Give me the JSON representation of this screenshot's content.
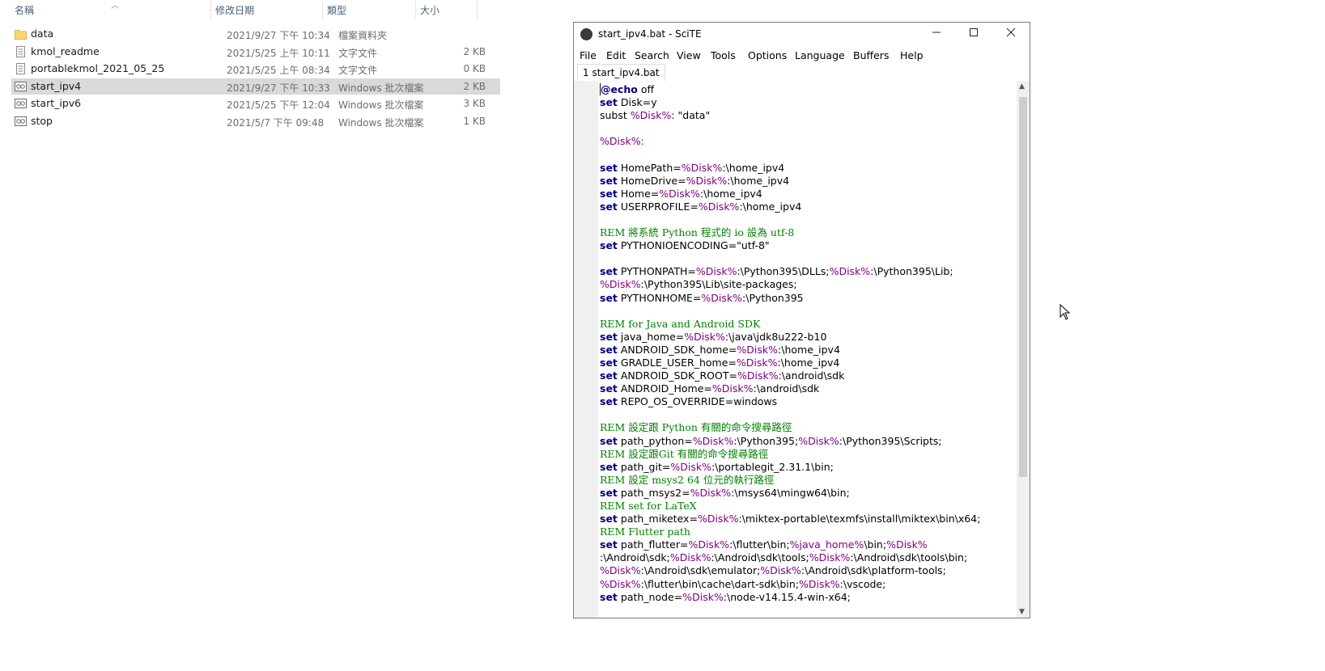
{
  "explorer": {
    "columns": {
      "name": "名稱",
      "date": "修改日期",
      "type": "類型",
      "size": "大小"
    },
    "files": [
      {
        "name": "data",
        "date": "2021/9/27 下午 10:34",
        "type": "檔案資料夾",
        "size": "",
        "icon": "folder-icon",
        "selected": false
      },
      {
        "name": "kmol_readme",
        "date": "2021/5/25 上午 10:11",
        "type": "文字文件",
        "size": "2 KB",
        "icon": "text-file-icon",
        "selected": false
      },
      {
        "name": "portablekmol_2021_05_25",
        "date": "2021/5/25 上午 08:34",
        "type": "文字文件",
        "size": "0 KB",
        "icon": "text-file-icon",
        "selected": false
      },
      {
        "name": "start_ipv4",
        "date": "2021/9/27 下午 10:33",
        "type": "Windows 批次檔案",
        "size": "2 KB",
        "icon": "batch-file-icon",
        "selected": true
      },
      {
        "name": "start_ipv6",
        "date": "2021/5/25 下午 12:04",
        "type": "Windows 批次檔案",
        "size": "3 KB",
        "icon": "batch-file-icon",
        "selected": false
      },
      {
        "name": "stop",
        "date": "2021/5/7 下午 09:48",
        "type": "Windows 批次檔案",
        "size": "1 KB",
        "icon": "batch-file-icon",
        "selected": false
      }
    ]
  },
  "scite": {
    "title": "start_ipv4.bat - SciTE",
    "menu": [
      "File",
      "Edit",
      "Search",
      "View",
      "Tools",
      "Options",
      "Language",
      "Buffers",
      "Help"
    ],
    "tab": "1 start_ipv4.bat",
    "lines": [
      [
        [
          "kw",
          "@echo"
        ],
        [
          "t",
          " off"
        ]
      ],
      [
        [
          "kw",
          "set"
        ],
        [
          "t",
          " Disk=y"
        ]
      ],
      [
        [
          "t",
          "subst "
        ],
        [
          "var",
          "%Disk%"
        ],
        [
          "t",
          ": \"data\""
        ]
      ],
      [],
      [
        [
          "lbl",
          "%Disk%:"
        ]
      ],
      [],
      [
        [
          "kw",
          "set"
        ],
        [
          "t",
          " HomePath="
        ],
        [
          "var",
          "%Disk%"
        ],
        [
          "t",
          ":\\home_ipv4"
        ]
      ],
      [
        [
          "kw",
          "set"
        ],
        [
          "t",
          " HomeDrive="
        ],
        [
          "var",
          "%Disk%"
        ],
        [
          "t",
          ":\\home_ipv4"
        ]
      ],
      [
        [
          "kw",
          "set"
        ],
        [
          "t",
          " Home="
        ],
        [
          "var",
          "%Disk%"
        ],
        [
          "t",
          ":\\home_ipv4"
        ]
      ],
      [
        [
          "kw",
          "set"
        ],
        [
          "t",
          " USERPROFILE="
        ],
        [
          "var",
          "%Disk%"
        ],
        [
          "t",
          ":\\home_ipv4"
        ]
      ],
      [],
      [
        [
          "rem",
          "REM 將系統 Python 程式的 io 設為 utf-8"
        ]
      ],
      [
        [
          "kw",
          "set"
        ],
        [
          "t",
          " PYTHONIOENCODING=\"utf-8\""
        ]
      ],
      [],
      [
        [
          "kw",
          "set"
        ],
        [
          "t",
          " PYTHONPATH="
        ],
        [
          "var",
          "%Disk%"
        ],
        [
          "t",
          ":\\Python395\\DLLs;"
        ],
        [
          "var",
          "%Disk%"
        ],
        [
          "t",
          ":\\Python395\\Lib;"
        ]
      ],
      [
        [
          "var",
          "%Disk%"
        ],
        [
          "t",
          ":\\Python395\\Lib\\site-packages;"
        ]
      ],
      [
        [
          "kw",
          "set"
        ],
        [
          "t",
          " PYTHONHOME="
        ],
        [
          "var",
          "%Disk%"
        ],
        [
          "t",
          ":\\Python395"
        ]
      ],
      [],
      [
        [
          "rem",
          "REM for Java and Android SDK"
        ]
      ],
      [
        [
          "kw",
          "set"
        ],
        [
          "t",
          " java_home="
        ],
        [
          "var",
          "%Disk%"
        ],
        [
          "t",
          ":\\java\\jdk8u222-b10"
        ]
      ],
      [
        [
          "kw",
          "set"
        ],
        [
          "t",
          " ANDROID_SDK_home="
        ],
        [
          "var",
          "%Disk%"
        ],
        [
          "t",
          ":\\home_ipv4"
        ]
      ],
      [
        [
          "kw",
          "set"
        ],
        [
          "t",
          " GRADLE_USER_home="
        ],
        [
          "var",
          "%Disk%"
        ],
        [
          "t",
          ":\\home_ipv4"
        ]
      ],
      [
        [
          "kw",
          "set"
        ],
        [
          "t",
          " ANDROID_SDK_ROOT="
        ],
        [
          "var",
          "%Disk%"
        ],
        [
          "t",
          ":\\android\\sdk"
        ]
      ],
      [
        [
          "kw",
          "set"
        ],
        [
          "t",
          " ANDROID_Home="
        ],
        [
          "var",
          "%Disk%"
        ],
        [
          "t",
          ":\\android\\sdk"
        ]
      ],
      [
        [
          "kw",
          "set"
        ],
        [
          "t",
          " REPO_OS_OVERRIDE=windows"
        ]
      ],
      [],
      [
        [
          "rem",
          "REM 設定跟 Python 有關的命令搜尋路徑"
        ]
      ],
      [
        [
          "kw",
          "set"
        ],
        [
          "t",
          " path_python="
        ],
        [
          "var",
          "%Disk%"
        ],
        [
          "t",
          ":\\Python395;"
        ],
        [
          "var",
          "%Disk%"
        ],
        [
          "t",
          ":\\Python395\\Scripts;"
        ]
      ],
      [
        [
          "rem",
          "REM 設定跟Git 有關的命令搜尋路徑"
        ]
      ],
      [
        [
          "kw",
          "set"
        ],
        [
          "t",
          " path_git="
        ],
        [
          "var",
          "%Disk%"
        ],
        [
          "t",
          ":\\portablegit_2.31.1\\bin;"
        ]
      ],
      [
        [
          "rem",
          "REM 設定 msys2 64 位元的執行路徑"
        ]
      ],
      [
        [
          "kw",
          "set"
        ],
        [
          "t",
          " path_msys2="
        ],
        [
          "var",
          "%Disk%"
        ],
        [
          "t",
          ":\\msys64\\mingw64\\bin;"
        ]
      ],
      [
        [
          "rem",
          "REM set for LaTeX"
        ]
      ],
      [
        [
          "kw",
          "set"
        ],
        [
          "t",
          " path_miketex="
        ],
        [
          "var",
          "%Disk%"
        ],
        [
          "t",
          ":\\miktex-portable\\texmfs\\install\\miktex\\bin\\x64;"
        ]
      ],
      [
        [
          "rem",
          "REM Flutter path"
        ]
      ],
      [
        [
          "kw",
          "set"
        ],
        [
          "t",
          " path_flutter="
        ],
        [
          "var",
          "%Disk%"
        ],
        [
          "t",
          ":\\flutter\\bin;"
        ],
        [
          "var",
          "%java_home%"
        ],
        [
          "t",
          "\\bin;"
        ],
        [
          "var",
          "%Disk%"
        ]
      ],
      [
        [
          "t",
          ":\\Android\\sdk;"
        ],
        [
          "var",
          "%Disk%"
        ],
        [
          "t",
          ":\\Android\\sdk\\tools;"
        ],
        [
          "var",
          "%Disk%"
        ],
        [
          "t",
          ":\\Android\\sdk\\tools\\bin;"
        ]
      ],
      [
        [
          "var",
          "%Disk%"
        ],
        [
          "t",
          ":\\Android\\sdk\\emulator;"
        ],
        [
          "var",
          "%Disk%"
        ],
        [
          "t",
          ":\\Android\\sdk\\platform-tools;"
        ]
      ],
      [
        [
          "var",
          "%Disk%"
        ],
        [
          "t",
          ":\\flutter\\bin\\cache\\dart-sdk\\bin;"
        ],
        [
          "var",
          "%Disk%"
        ],
        [
          "t",
          ":\\vscode;"
        ]
      ],
      [
        [
          "kw",
          "set"
        ],
        [
          "t",
          " path_node="
        ],
        [
          "var",
          "%Disk%"
        ],
        [
          "t",
          ":\\node-v14.15.4-win-x64;"
        ]
      ]
    ]
  }
}
